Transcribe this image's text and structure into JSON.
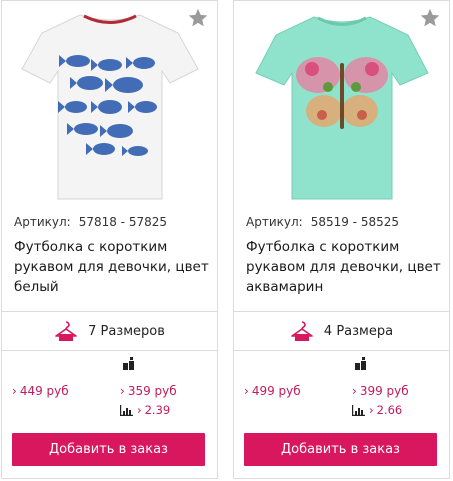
{
  "products": [
    {
      "sku_label": "Артикул:",
      "sku": "57818 - 57825",
      "title": "Футболка с коротким рукавом для девочки, цвет белый",
      "sizes": "7 Размеров",
      "price": "449 руб",
      "price_opt": "359 руб",
      "stat": "2.39",
      "button": "Добавить в заказ",
      "icons": {
        "favorite": "star-icon",
        "sizes": "hanger-icon",
        "wholesale": "wholesale-icon",
        "stat": "bar-chart-icon"
      }
    },
    {
      "sku_label": "Артикул:",
      "sku": "58519 - 58525",
      "title": "Футболка с коротким рукавом для девочки, цвет аквамарин",
      "sizes": "4 Размера",
      "price": "499 руб",
      "price_opt": "399 руб",
      "stat": "2.66",
      "button": "Добавить в заказ",
      "icons": {
        "favorite": "star-icon",
        "sizes": "hanger-icon",
        "wholesale": "wholesale-icon",
        "stat": "bar-chart-icon"
      }
    }
  ],
  "colors": {
    "accent": "#d8175e",
    "price": "#c3195d",
    "border": "#dcdcdc",
    "star": "#9a9a9a",
    "shirt_white": "#f4f4f4",
    "shirt_aqua": "#8fe3cc"
  }
}
